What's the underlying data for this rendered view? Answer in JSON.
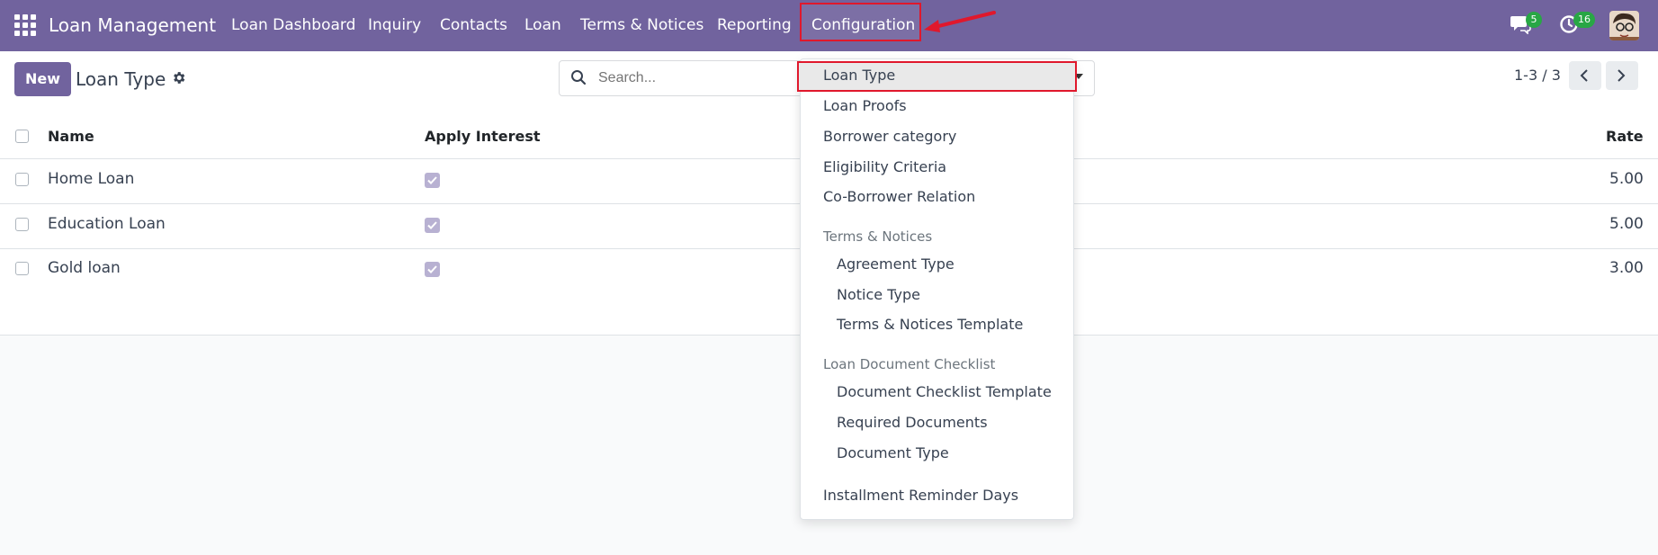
{
  "navbar": {
    "brand": "Loan Management",
    "items": [
      {
        "label": "Loan Dashboard"
      },
      {
        "label": "Inquiry"
      },
      {
        "label": "Contacts"
      },
      {
        "label": "Loan"
      },
      {
        "label": "Terms & Notices"
      },
      {
        "label": "Reporting"
      },
      {
        "label": "Configuration"
      }
    ],
    "messages_count": "5",
    "activities_count": "16",
    "accent_color": "#71639e"
  },
  "control_panel": {
    "new_label": "New",
    "title": "Loan Type",
    "search_placeholder": "Search...",
    "pager": "1-3 / 3"
  },
  "table": {
    "columns": [
      "Name",
      "Apply Interest",
      "Rate"
    ],
    "rows": [
      {
        "name": "Home Loan",
        "apply_interest": true,
        "rate": "5.00"
      },
      {
        "name": "Education Loan",
        "apply_interest": true,
        "rate": "5.00"
      },
      {
        "name": "Gold loan",
        "apply_interest": true,
        "rate": "3.00"
      }
    ]
  },
  "dropdown": {
    "items": [
      {
        "label": "Loan Type"
      },
      {
        "label": "Loan Proofs"
      },
      {
        "label": "Borrower category"
      },
      {
        "label": "Eligibility Criteria"
      },
      {
        "label": "Co-Borrower Relation"
      }
    ],
    "section_terms": "Terms & Notices",
    "terms_items": [
      {
        "label": "Agreement Type"
      },
      {
        "label": "Notice Type"
      },
      {
        "label": "Terms & Notices Template"
      }
    ],
    "section_docs": "Loan Document Checklist",
    "docs_items": [
      {
        "label": "Document Checklist Template"
      },
      {
        "label": "Required Documents"
      },
      {
        "label": "Document Type"
      }
    ],
    "footer_item": "Installment Reminder Days"
  }
}
